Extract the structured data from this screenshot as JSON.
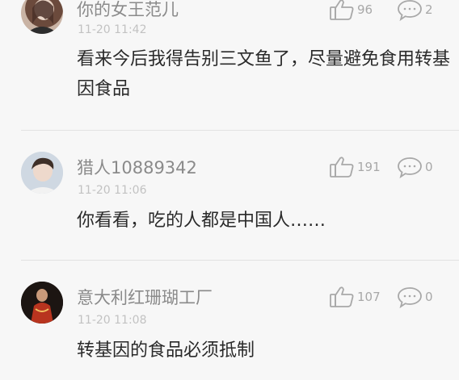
{
  "comments": [
    {
      "username": "你的女王范儿",
      "time": "11-20 11:42",
      "likes": "96",
      "replies": "2",
      "text": "看来今后我得告别三文鱼了，尽量避免食用转基因食品"
    },
    {
      "username": "猎人10889342",
      "time": "11-20 11:06",
      "likes": "191",
      "replies": "0",
      "text": "你看看，吃的人都是中国人……"
    },
    {
      "username": "意大利红珊瑚工厂",
      "time": "11-20 11:08",
      "likes": "107",
      "replies": "0",
      "text": "转基因的食品必须抵制"
    }
  ],
  "icons": {
    "like": "thumbs-up-icon",
    "reply": "comment-bubble-icon"
  },
  "colors": {
    "background": "#f7f7f7",
    "username": "#8a8a8a",
    "timestamp": "#c2c2c2",
    "icon": "#a8a8a8",
    "text": "#2a2a2a"
  }
}
